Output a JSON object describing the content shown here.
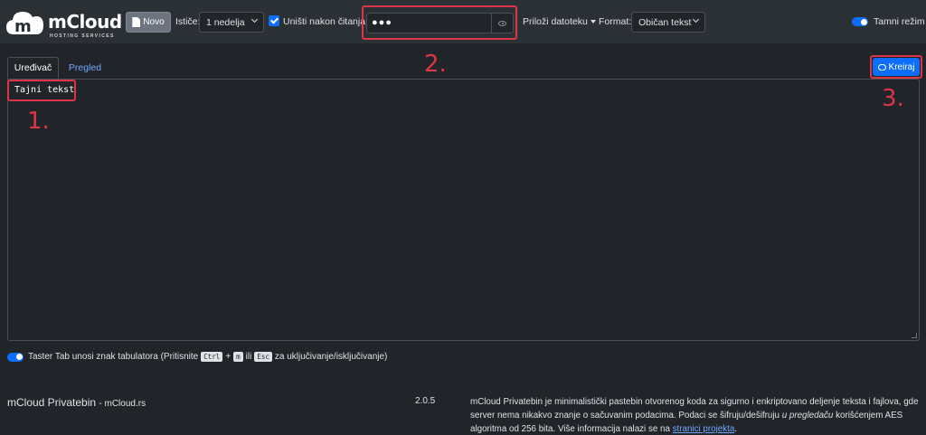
{
  "header": {
    "brand": "mCloud",
    "brand_tagline": "HOSTING SERVICES",
    "logo_letter": "m",
    "new_button_label": "Novo",
    "expires_label": "Ističe:",
    "expires_value": "1 nedelja",
    "burn_after_reading_label": "Uništi nakon čitanja",
    "burn_after_reading_checked": true,
    "password_value": "●●●",
    "attach_label": "Priloži datoteku",
    "format_label": "Format:",
    "format_value": "Običan tekst",
    "dark_mode_label": "Tamni režim",
    "dark_mode_on": true
  },
  "tabs": {
    "editor_label": "Uređivač",
    "preview_label": "Pregled"
  },
  "create_button_label": "Kreiraj",
  "editor": {
    "content": "Tajni tekst"
  },
  "tab_key_notice": {
    "text_before": "Taster Tab unosi znak tabulatora (Pritisnite",
    "key_ctrl": "Ctrl",
    "plus": "+",
    "key_m": "m",
    "or": "ili",
    "key_esc": "Esc",
    "text_after": "za uključivanje/isključivanje)"
  },
  "footer": {
    "app_name": "mCloud Privatebin",
    "site": "- mCloud.rs",
    "version": "2.0.5",
    "description_part1": "mCloud Privatebin je minimalistički pastebin otvorenog koda za sigurno i enkriptovano deljenje teksta i fajlova, gde server nema nikakvo znanje o sačuvanim podacima. Podaci se šifruju/dešifruju",
    "description_emph": "u pregledaču",
    "description_part2": "korišćenjem AES algoritma od 256 bita. Više informacija nalazi se na",
    "description_link": "stranici projekta",
    "description_end": "."
  },
  "annotations": {
    "one": "1.",
    "two": "2.",
    "three": "3.",
    "color": "#dc3545"
  },
  "colors": {
    "background": "#212529",
    "navbar": "#2b3035",
    "accent": "#0d6efd",
    "link": "#6ea8fe"
  }
}
